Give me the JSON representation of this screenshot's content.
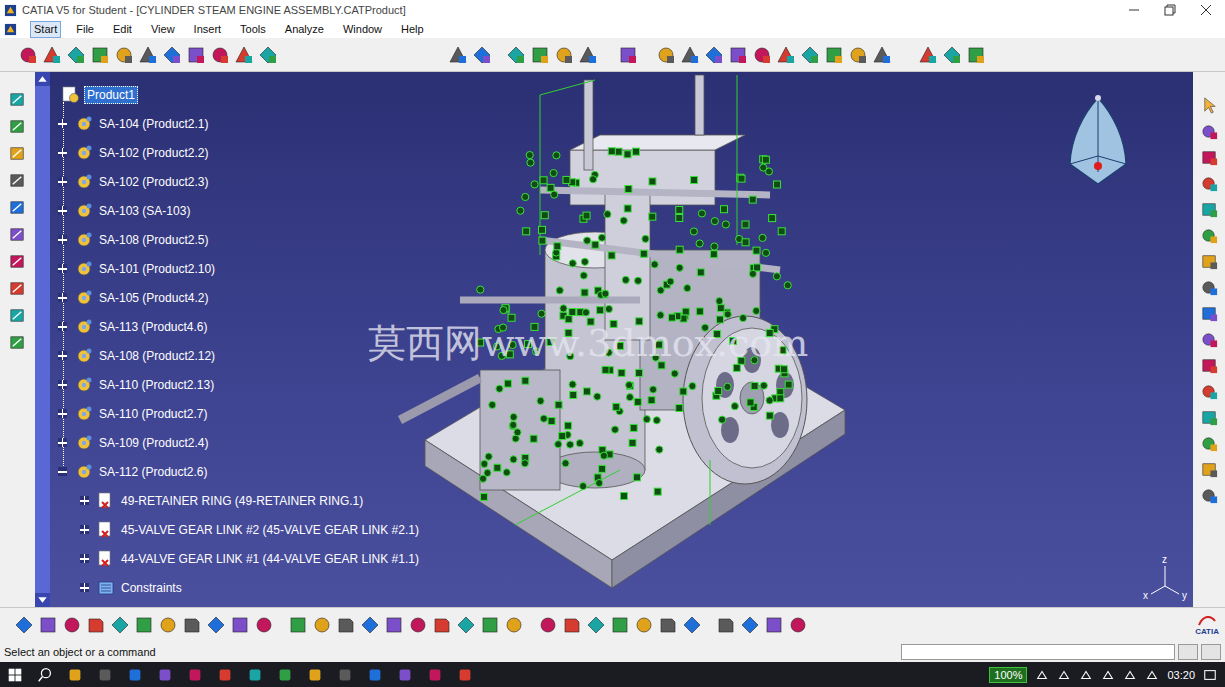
{
  "window": {
    "title": "CATIA V5 for Student - [CYLINDER STEAM ENGINE ASSEMBLY.CATProduct]"
  },
  "menu": [
    {
      "label": "Start",
      "selected": true
    },
    {
      "label": "File",
      "selected": false
    },
    {
      "label": "Edit",
      "selected": false
    },
    {
      "label": "View",
      "selected": false
    },
    {
      "label": "Insert",
      "selected": false
    },
    {
      "label": "Tools",
      "selected": false
    },
    {
      "label": "Analyze",
      "selected": false
    },
    {
      "label": "Window",
      "selected": false
    },
    {
      "label": "Help",
      "selected": false
    }
  ],
  "tree": {
    "root": {
      "label": "Product1",
      "selected": true
    },
    "items": [
      {
        "label": "SA-104 (Product2.1)",
        "level": 1,
        "kind": "product",
        "expanded": false
      },
      {
        "label": "SA-102 (Product2.2)",
        "level": 1,
        "kind": "product",
        "expanded": false
      },
      {
        "label": "SA-102 (Product2.3)",
        "level": 1,
        "kind": "product",
        "expanded": false
      },
      {
        "label": "SA-103 (SA-103)",
        "level": 1,
        "kind": "product",
        "expanded": false
      },
      {
        "label": "SA-108 (Product2.5)",
        "level": 1,
        "kind": "product",
        "expanded": false
      },
      {
        "label": "SA-101 (Product2.10)",
        "level": 1,
        "kind": "product",
        "expanded": false
      },
      {
        "label": "SA-105 (Product4.2)",
        "level": 1,
        "kind": "product",
        "expanded": false
      },
      {
        "label": "SA-113 (Product4.6)",
        "level": 1,
        "kind": "product",
        "expanded": false
      },
      {
        "label": "SA-108 (Product2.12)",
        "level": 1,
        "kind": "product",
        "expanded": false
      },
      {
        "label": "SA-110 (Product2.13)",
        "level": 1,
        "kind": "product",
        "expanded": false
      },
      {
        "label": "SA-110 (Product2.7)",
        "level": 1,
        "kind": "product",
        "expanded": false
      },
      {
        "label": "SA-109 (Product2.4)",
        "level": 1,
        "kind": "product",
        "expanded": false
      },
      {
        "label": "SA-112 (Product2.6)",
        "level": 1,
        "kind": "product",
        "expanded": true
      },
      {
        "label": "49-RETAINER RING (49-RETAINER RING.1)",
        "level": 2,
        "kind": "part",
        "expanded": false
      },
      {
        "label": "45-VALVE GEAR LINK #2 (45-VALVE GEAR LINK #2.1)",
        "level": 2,
        "kind": "part",
        "expanded": false
      },
      {
        "label": "44-VALVE GEAR LINK #1 (44-VALVE GEAR LINK #1.1)",
        "level": 2,
        "kind": "part",
        "expanded": false
      },
      {
        "label": "Constraints",
        "level": 2,
        "kind": "constraints",
        "expanded": false
      }
    ]
  },
  "watermark": "莫西网www.3dmox.com",
  "triad": {
    "z": "z",
    "x": "x",
    "y": "y"
  },
  "brand": "CATIA",
  "status_bar": {
    "prompt": "Select an object or a command"
  },
  "taskbar": {
    "zoom": "100%",
    "time": "03:20"
  }
}
